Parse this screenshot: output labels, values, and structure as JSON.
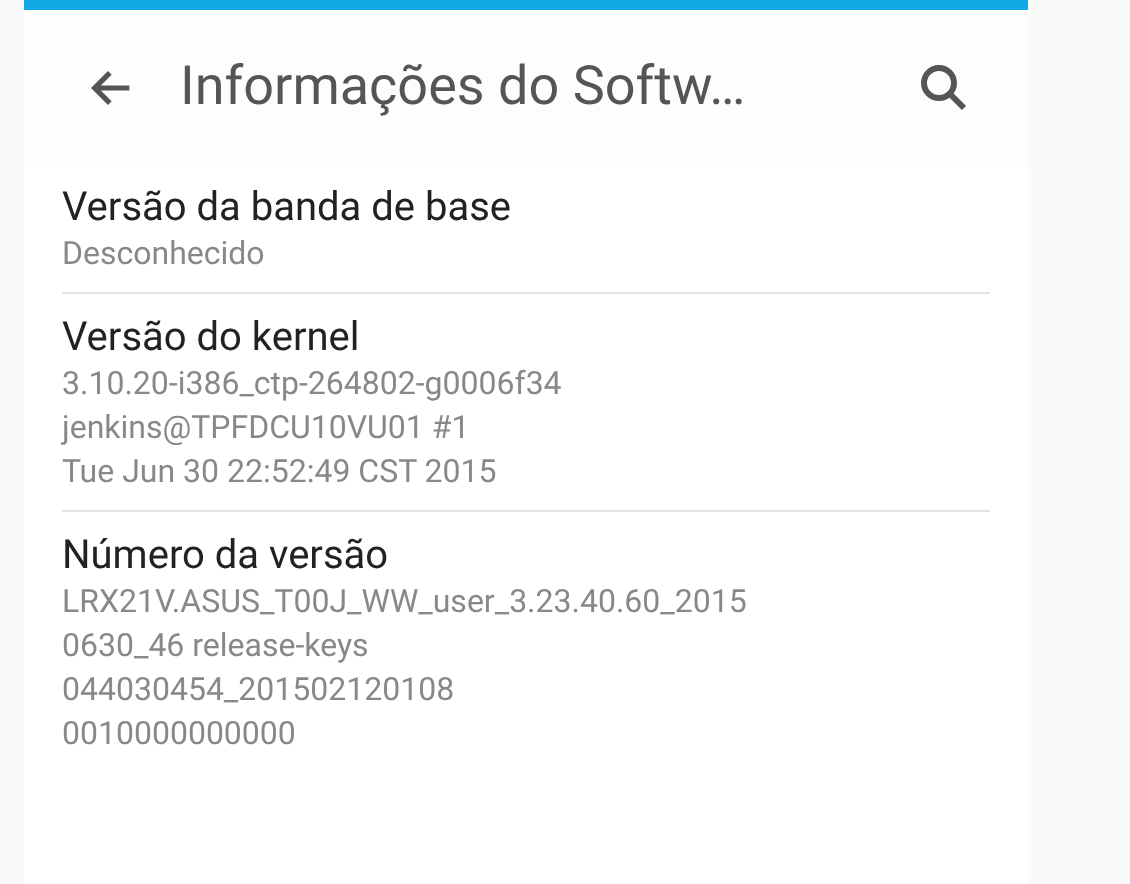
{
  "header": {
    "title": "Informações do Softw…"
  },
  "items": [
    {
      "label": "Versão da banda de base",
      "lines": [
        "Desconhecido"
      ]
    },
    {
      "label": "Versão do kernel",
      "lines": [
        "3.10.20-i386_ctp-264802-g0006f34",
        "jenkins@TPFDCU10VU01 #1",
        "Tue Jun 30 22:52:49 CST 2015"
      ]
    },
    {
      "label": "Número da versão",
      "lines": [
        "LRX21V.ASUS_T00J_WW_user_3.23.40.60_2015",
        "0630_46 release-keys",
        "044030454_201502120108",
        "0010000000000"
      ]
    }
  ]
}
